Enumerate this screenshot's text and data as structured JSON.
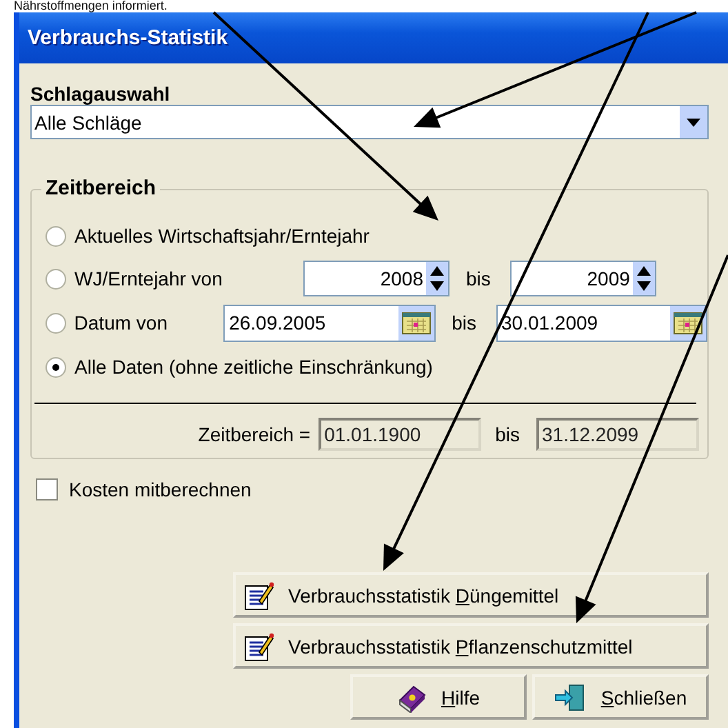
{
  "caption": "Nährstoffmengen informiert.",
  "window": {
    "title": "Verbrauchs-Statistik"
  },
  "field_selection": {
    "label": "Schlagauswahl",
    "value": "Alle Schläge"
  },
  "time_range": {
    "title": "Zeitbereich",
    "options": [
      {
        "kind": "plain",
        "label": "Aktuelles Wirtschaftsjahr/Erntejahr",
        "selected": false
      },
      {
        "kind": "years",
        "label": "WJ/Erntejahr von",
        "from": "2008",
        "to_label": "bis",
        "to": "2009",
        "selected": false
      },
      {
        "kind": "dates",
        "label": "Datum von",
        "from": "26.09.2005",
        "to_label": "bis",
        "to": "30.01.2009",
        "selected": false
      },
      {
        "kind": "plain",
        "label": "Alle Daten (ohne zeitliche Einschränkung)",
        "selected": true
      }
    ],
    "result": {
      "label": "Zeitbereich =",
      "from": "01.01.1900",
      "to_label": "bis",
      "to": "31.12.2099"
    }
  },
  "include_costs": {
    "label": "Kosten mitberechnen",
    "checked": false
  },
  "buttons": [
    {
      "kind": "report",
      "before": "Verbrauchsstatistik ",
      "key": "D",
      "after": "üngemittel"
    },
    {
      "kind": "report",
      "before": "Verbrauchsstatistik ",
      "key": "P",
      "after": "flanzenschutzmittel"
    },
    {
      "kind": "help",
      "key": "H",
      "after": "ilfe"
    },
    {
      "kind": "close",
      "key": "S",
      "after": "chließen"
    }
  ]
}
